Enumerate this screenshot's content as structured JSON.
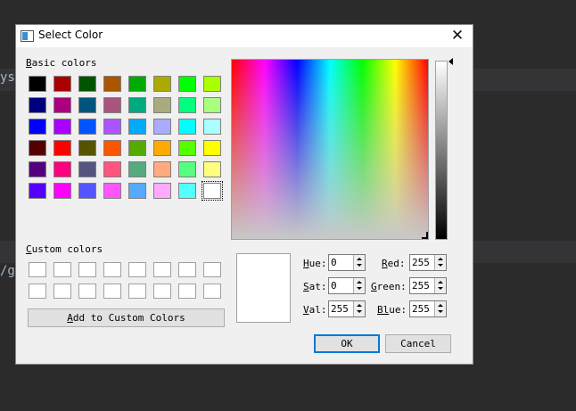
{
  "dialog": {
    "title": "Select Color"
  },
  "basic_colors": {
    "label_prefix": "B",
    "label_rest": "asic colors",
    "swatches": [
      "#000000",
      "#aa0000",
      "#005500",
      "#aa5500",
      "#00aa00",
      "#aaaa00",
      "#00ff00",
      "#aaff00",
      "#00007f",
      "#aa007f",
      "#00557f",
      "#aa557f",
      "#00aa7f",
      "#aaaa7f",
      "#00ff7f",
      "#aaff7f",
      "#0000ff",
      "#aa00ff",
      "#0055ff",
      "#aa55ff",
      "#00aaff",
      "#aaaaff",
      "#00ffff",
      "#aaffff",
      "#550000",
      "#ff0000",
      "#555500",
      "#ff5500",
      "#55aa00",
      "#ffaa00",
      "#55ff00",
      "#ffff00",
      "#55007f",
      "#ff007f",
      "#55557f",
      "#ff557f",
      "#55aa7f",
      "#ffaa7f",
      "#55ff7f",
      "#ffff7f",
      "#5500ff",
      "#ff00ff",
      "#5555ff",
      "#ff55ff",
      "#55aaff",
      "#ffaaff",
      "#55ffff",
      "#ffffff"
    ],
    "selected_index": 47
  },
  "custom_colors": {
    "label_prefix": "C",
    "label_rest": "ustom colors",
    "slot_count": 16
  },
  "add_custom_button": {
    "prefix": "A",
    "rest": "dd to Custom Colors"
  },
  "fields": {
    "hue": {
      "prefix": "H",
      "rest": "ue:",
      "value": "0"
    },
    "sat": {
      "prefix": "S",
      "rest": "at:",
      "value": "0"
    },
    "val": {
      "prefix": "V",
      "rest": "al:",
      "value": "255"
    },
    "red": {
      "prefix": "R",
      "rest": "ed:",
      "value": "255"
    },
    "green": {
      "prefix": "G",
      "rest": "reen:",
      "value": "255"
    },
    "blue": {
      "prefix": "Bl",
      "rest": "ue:",
      "value": "255"
    }
  },
  "buttons": {
    "ok": "OK",
    "cancel": "Cancel"
  },
  "current_color": "#ffffff",
  "background_editor": {
    "line1": "ys",
    "line2": "/g"
  }
}
